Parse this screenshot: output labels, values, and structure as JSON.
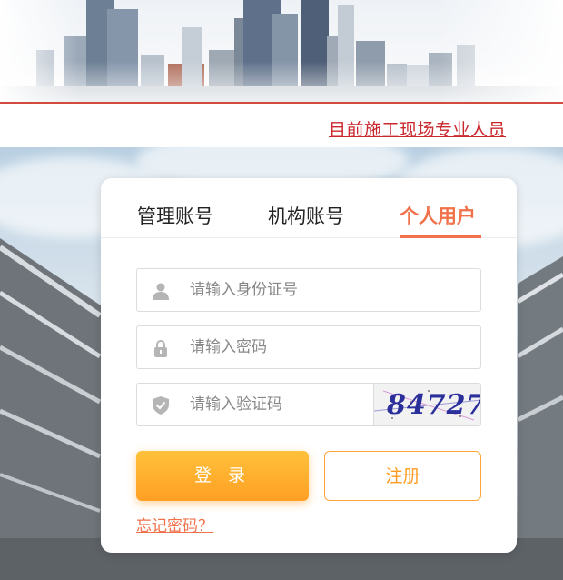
{
  "notice": {
    "text": "目前施工现场专业人员"
  },
  "tabs": [
    {
      "label": "管理账号",
      "active": false
    },
    {
      "label": "机构账号",
      "active": false
    },
    {
      "label": "个人用户",
      "active": true
    }
  ],
  "form": {
    "id_placeholder": "请输入身份证号",
    "password_placeholder": "请输入密码",
    "captcha_placeholder": "请输入验证码",
    "captcha_code": "84727"
  },
  "buttons": {
    "login_label": "登 录",
    "register_label": "注册"
  },
  "forgot_label": "忘记密码？",
  "colors": {
    "accent": "#f0714a",
    "notice_red": "#c9282d",
    "login_gradient_top": "#ffc13b",
    "login_gradient_bottom": "#ff9f23"
  }
}
